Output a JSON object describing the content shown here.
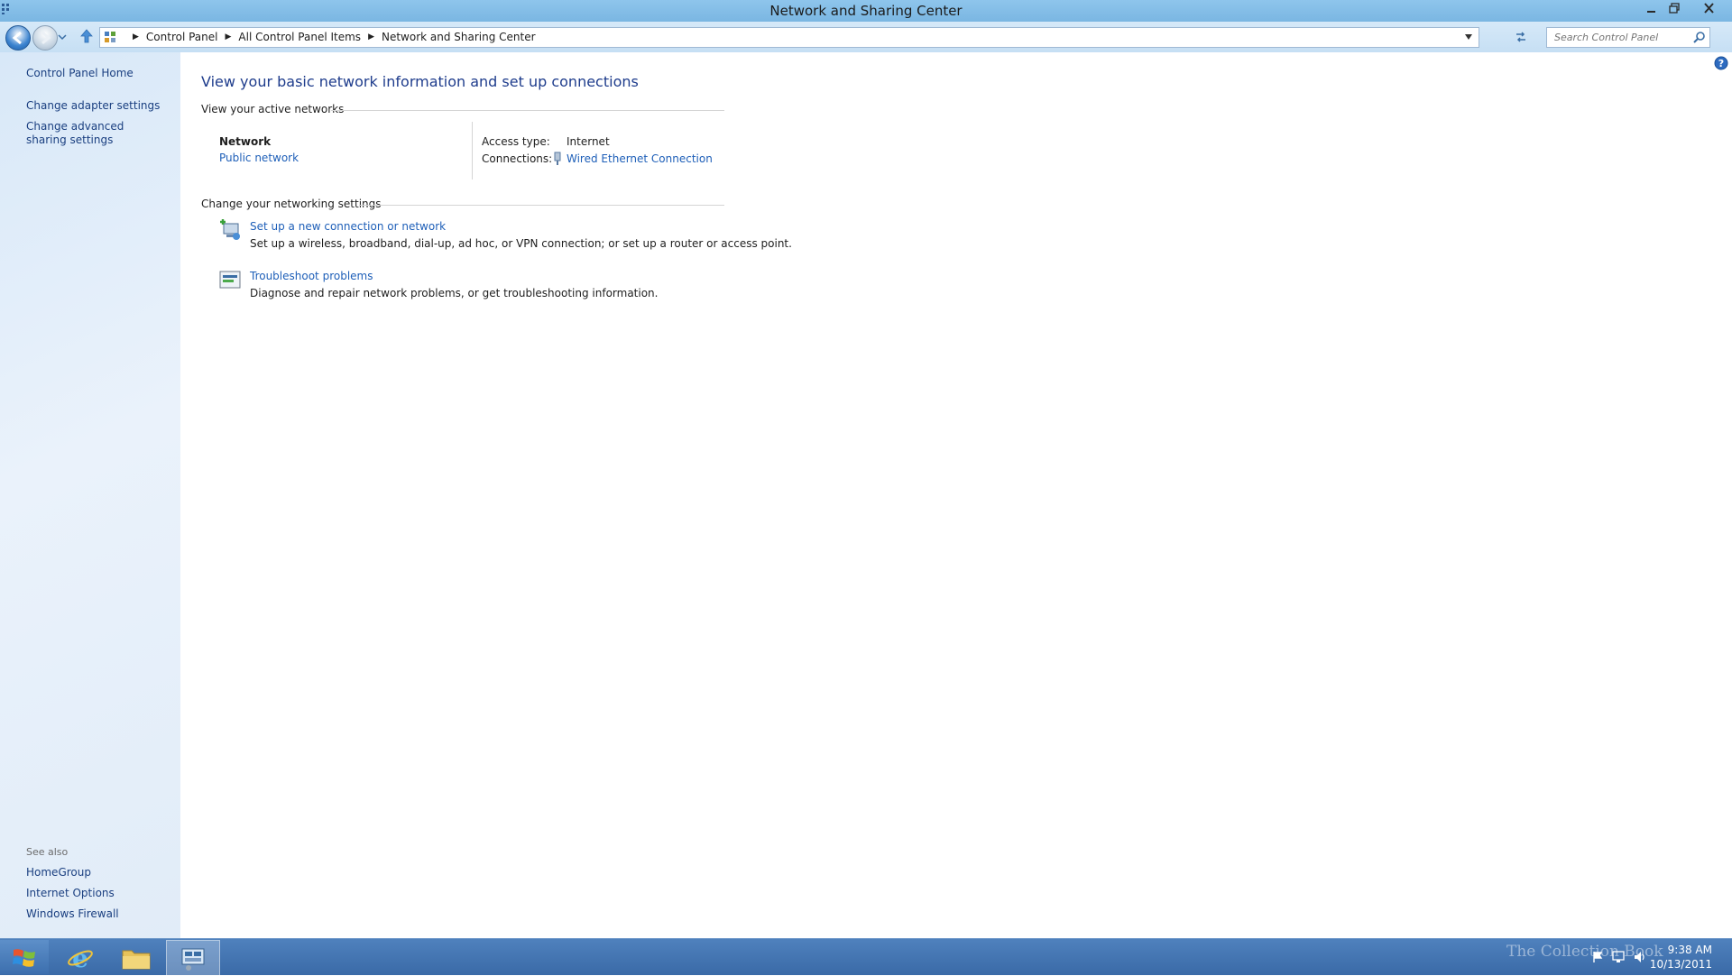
{
  "window": {
    "title": "Network and Sharing Center"
  },
  "address_bar": {
    "breadcrumbs": [
      "Control Panel",
      "All Control Panel Items",
      "Network and Sharing Center"
    ],
    "search_placeholder": "Search Control Panel"
  },
  "left_pane": {
    "links": [
      "Control Panel Home",
      "Change adapter settings",
      "Change advanced sharing settings"
    ],
    "see_also_label": "See also",
    "see_also": [
      "HomeGroup",
      "Internet Options",
      "Windows Firewall"
    ]
  },
  "main": {
    "heading": "View your basic network information and set up connections",
    "active_networks_label": "View your active networks",
    "network": {
      "name": "Network",
      "category": "Public network",
      "access_type_label": "Access type:",
      "access_type": "Internet",
      "connections_label": "Connections:",
      "connection": "Wired Ethernet Connection"
    },
    "change_settings_label": "Change your networking settings",
    "tasks": [
      {
        "title": "Set up a new connection or network",
        "description": "Set up a wireless, broadband, dial-up, ad hoc, or VPN connection; or set up a router or access point.",
        "icon": "new-connection-icon"
      },
      {
        "title": "Troubleshoot problems",
        "description": "Diagnose and repair network problems, or get troubleshooting information.",
        "icon": "troubleshoot-icon"
      }
    ]
  },
  "taskbar": {
    "time": "9:38 AM",
    "date": "10/13/2011",
    "watermark": "The Collection Book"
  },
  "colors": {
    "link": "#1e5fb8",
    "heading": "#1e3c8c",
    "titlebar": "#8ec5ec",
    "taskbar": "#4f81bd"
  }
}
